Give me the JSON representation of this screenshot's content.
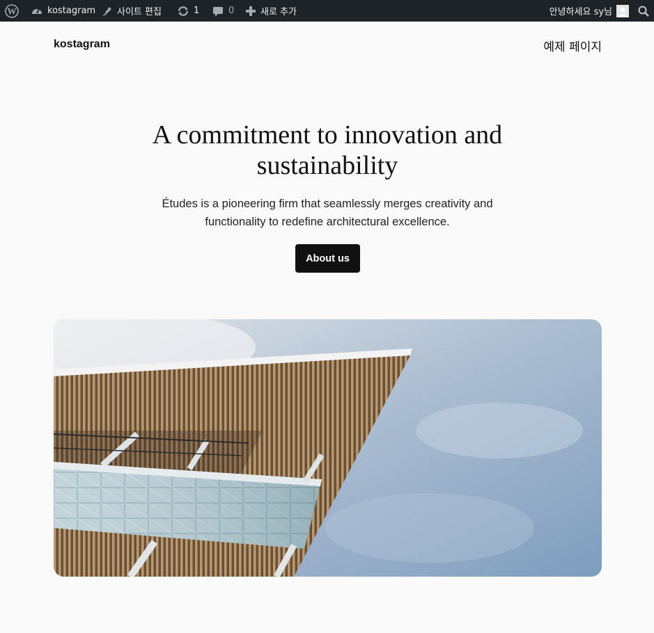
{
  "admin_bar": {
    "site_name": "kostagram",
    "edit_site": "사이트 편집",
    "updates_count": "1",
    "comments_count": "0",
    "new_label": "새로 추가",
    "greeting": "안녕하세요 sy님",
    "icons": {
      "wordpress": "wordpress-logo-icon",
      "site": "dashboard-icon",
      "edit": "brush-icon",
      "updates": "refresh-icon",
      "comments": "comment-bubble-icon",
      "new": "plus-icon",
      "avatar": "user-avatar-icon",
      "search": "search-icon"
    }
  },
  "header": {
    "site_title": "kostagram",
    "nav_link": "예제 페이지"
  },
  "hero": {
    "heading_line1": "A commitment to innovation and",
    "heading_line2": "sustainability",
    "subtext_line1": "Études is a pioneering firm that seamlessly merges creativity and",
    "subtext_line2": "functionality to redefine architectural excellence.",
    "button_label": "About us"
  },
  "colors": {
    "admin_bar_bg": "#1d2327",
    "page_bg": "#f9f9f9",
    "button_bg": "#111111",
    "text": "#111111"
  }
}
